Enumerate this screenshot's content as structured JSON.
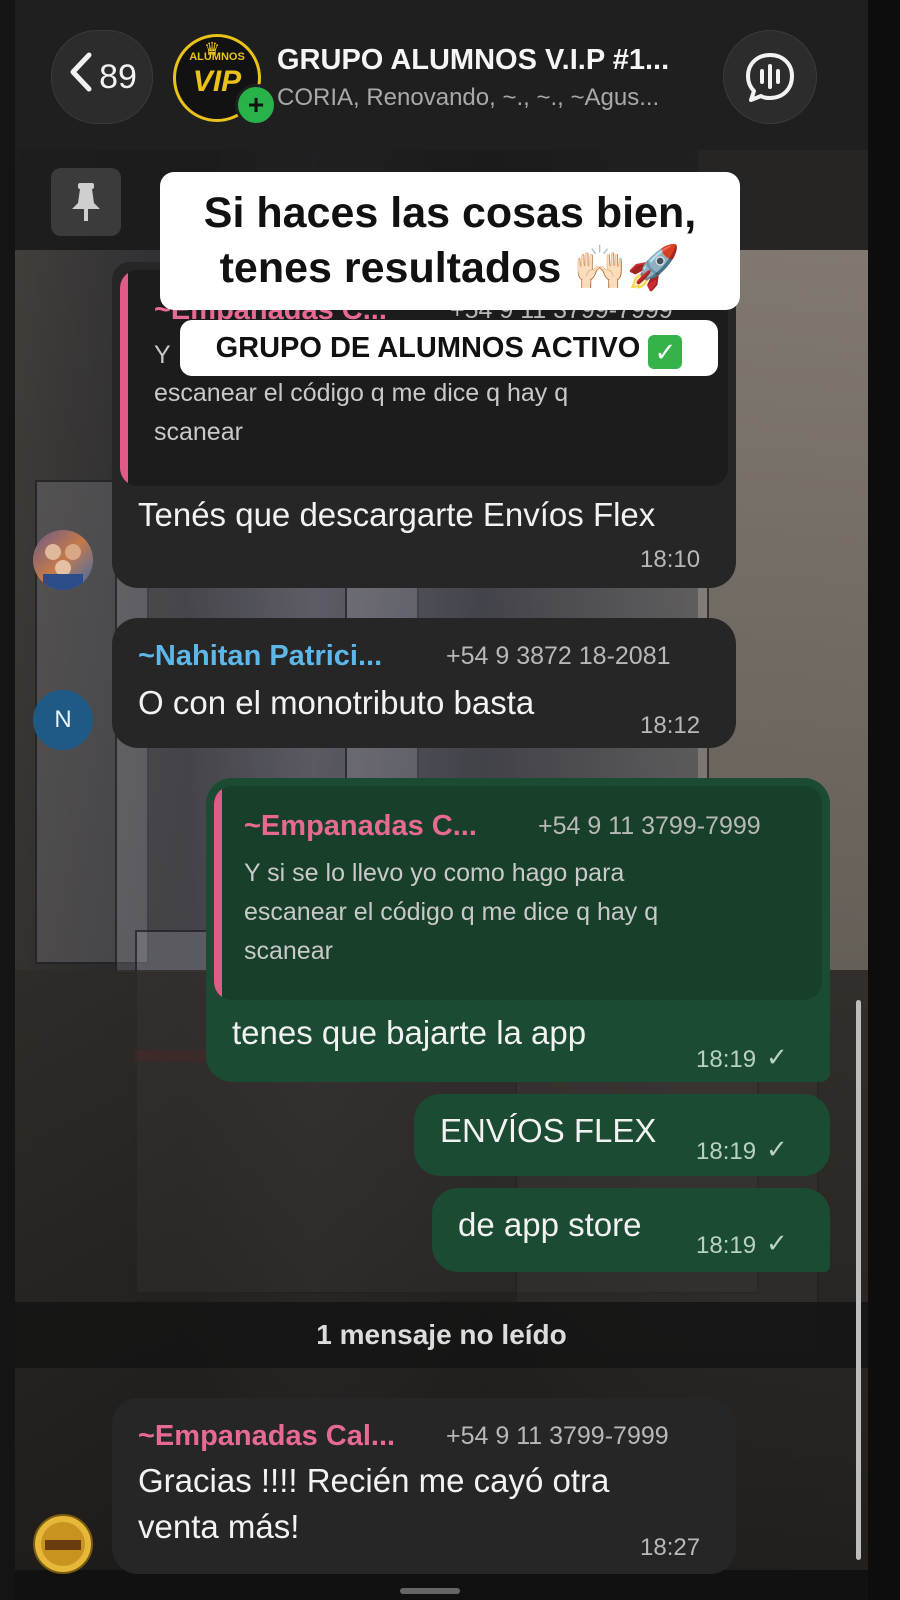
{
  "header": {
    "back_count": "89",
    "avatar_label_top": "ALUMNOS",
    "avatar_label_main": "VIP",
    "title": "GRUPO ALUMNOS V.I.P #1...",
    "subtitle": "CORIA, Renovando, ~., ~., ~Agus..."
  },
  "overlay": {
    "caption_line1": "Si haces las cosas bien,",
    "caption_line2": "tenes resultados 🙌🏻🚀",
    "tag": "GRUPO DE ALUMNOS ACTIVO",
    "tag_check": "✓"
  },
  "messages": {
    "m1": {
      "quote_sender": "~Empanadas C...",
      "quote_phone": "+54 9 11 3799-7999",
      "quote_line1": "Y",
      "quote_line2": "escanear el código q me dice q hay q",
      "quote_line3": "scanear",
      "text": "Tenés que descargarte Envíos Flex",
      "time": "18:10"
    },
    "m2": {
      "sender": "~Nahitan Patrici...",
      "phone": "+54 9 3872 18-2081",
      "avatar_initial": "N",
      "text": "O con el monotributo basta",
      "time": "18:12"
    },
    "m3": {
      "quote_sender": "~Empanadas C...",
      "quote_phone": "+54 9 11 3799-7999",
      "quote_line1": "Y si se lo llevo yo como hago para",
      "quote_line2": "escanear el código q me dice q hay q",
      "quote_line3": "scanear",
      "text": "tenes que bajarte la app",
      "time": "18:19"
    },
    "m4": {
      "text": "ENVÍOS FLEX",
      "time": "18:19"
    },
    "m5": {
      "text": "de app store",
      "time": "18:19"
    },
    "unread": "1 mensaje no leído",
    "m6": {
      "sender": "~Empanadas Cal...",
      "phone": "+54 9 11 3799-7999",
      "line1": "Gracias !!!! Recién me cayó otra",
      "line2": "venta más!",
      "time": "18:27"
    }
  },
  "icons": {
    "back": "chevron-left-icon",
    "voice": "voice-chat-icon",
    "pin": "pin-icon",
    "read": "check-icon"
  },
  "colors": {
    "incoming_bubble": "#262626",
    "outgoing_bubble": "#1b4b32",
    "quote_bar": "#e05b8a",
    "sender_pink": "#e86a93",
    "sender_blue": "#5db7e8",
    "online_plus": "#27b24a",
    "vip_gold": "#e9c21a"
  }
}
